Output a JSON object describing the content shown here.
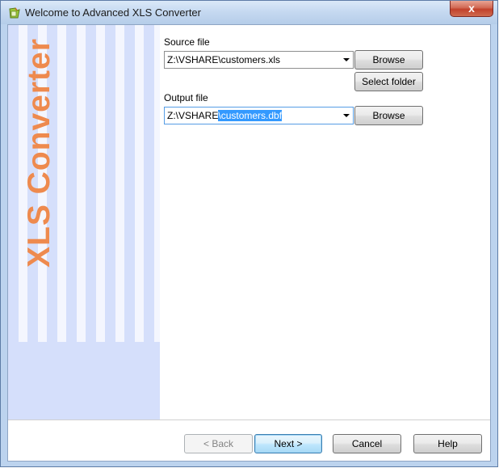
{
  "window": {
    "title": "Welcome to Advanced XLS Converter",
    "close_label": "x",
    "app_icon": "xls-converter-app-icon"
  },
  "sidebar": {
    "banner_text": "XLS Converter",
    "colors": {
      "banner": "#ee8a4e",
      "panel": "#d5dffb"
    }
  },
  "source": {
    "label": "Source file",
    "value": "Z:\\VSHARE\\customers.xls",
    "browse_label": "Browse",
    "select_folder_label": "Select folder"
  },
  "output": {
    "label": "Output file",
    "value_prefix": "Z:\\VSHARE",
    "value_selected": "\\customers.dbf",
    "browse_label": "Browse"
  },
  "footer": {
    "back_label": "< Back",
    "next_label": "Next >",
    "cancel_label": "Cancel",
    "help_label": "Help"
  }
}
